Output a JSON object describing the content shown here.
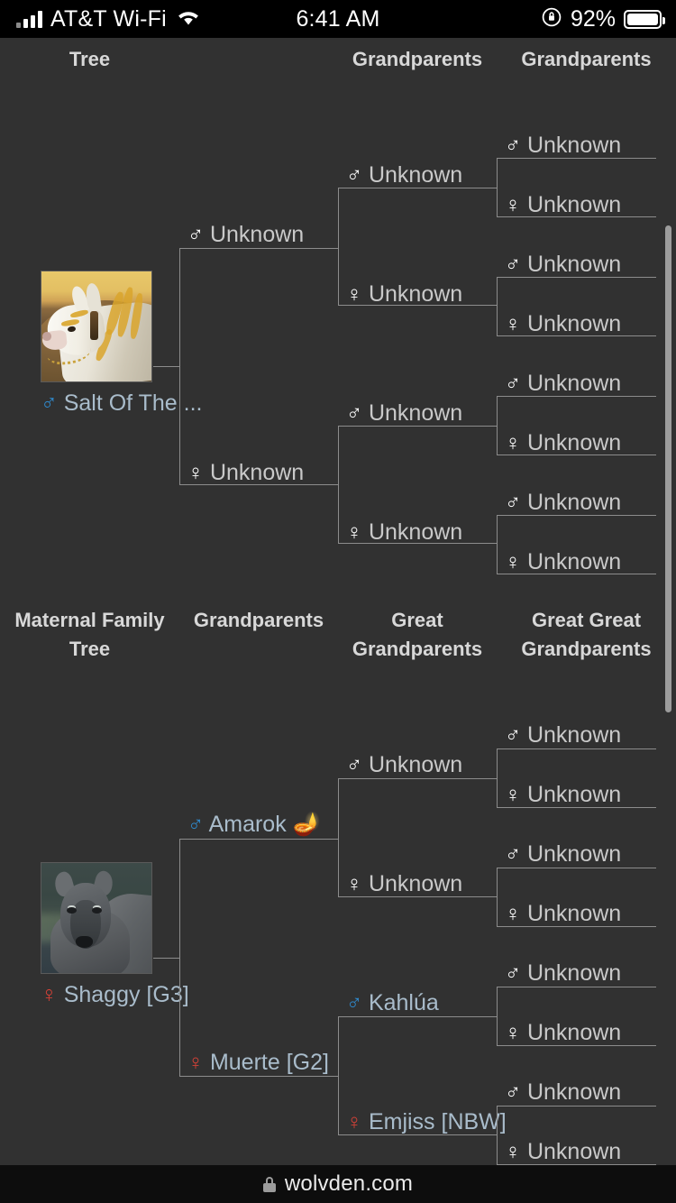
{
  "status_bar": {
    "carrier": "AT&T Wi-Fi",
    "time": "6:41 AM",
    "battery_percent": "92%",
    "signal_icon": "cellular-bars-icon",
    "wifi_icon": "wifi-icon",
    "orientation_lock_icon": "rotation-lock-icon",
    "battery_icon": "battery-icon"
  },
  "browser": {
    "url": "wolvden.com",
    "lock_icon": "lock-icon"
  },
  "paternal": {
    "headers": [
      "Tree",
      "",
      "Grandparents",
      "Grandparents"
    ],
    "header_note_clipped": "Paternal Family Tree header is scrolled partly off-screen",
    "subject": {
      "name": "Salt Of The ...",
      "sex": "male",
      "symbol": "♂",
      "art": "art-salt"
    },
    "parents": [
      {
        "name": "Unknown",
        "sex": "male",
        "symbol": "♂"
      },
      {
        "name": "Unknown",
        "sex": "female",
        "symbol": "♀"
      }
    ],
    "grandparents": [
      {
        "name": "Unknown",
        "sex": "male",
        "symbol": "♂"
      },
      {
        "name": "Unknown",
        "sex": "female",
        "symbol": "♀"
      },
      {
        "name": "Unknown",
        "sex": "male",
        "symbol": "♂"
      },
      {
        "name": "Unknown",
        "sex": "female",
        "symbol": "♀"
      }
    ],
    "great_grandparents": [
      {
        "name": "Unknown",
        "sex": "male",
        "symbol": "♂"
      },
      {
        "name": "Unknown",
        "sex": "female",
        "symbol": "♀"
      },
      {
        "name": "Unknown",
        "sex": "male",
        "symbol": "♂"
      },
      {
        "name": "Unknown",
        "sex": "female",
        "symbol": "♀"
      },
      {
        "name": "Unknown",
        "sex": "male",
        "symbol": "♂"
      },
      {
        "name": "Unknown",
        "sex": "female",
        "symbol": "♀"
      },
      {
        "name": "Unknown",
        "sex": "male",
        "symbol": "♂"
      },
      {
        "name": "Unknown",
        "sex": "female",
        "symbol": "♀"
      }
    ]
  },
  "maternal": {
    "headers": [
      "Maternal Family Tree",
      "Grandparents",
      "Great Grandparents",
      "Great Great Grandparents"
    ],
    "subject": {
      "name": "Shaggy [G3]",
      "sex": "female",
      "symbol": "♀",
      "art": "art-shaggy"
    },
    "parents": [
      {
        "name": "Amarok 🪔",
        "sex": "male",
        "symbol": "♂",
        "link": true
      },
      {
        "name": "Muerte [G2]",
        "sex": "female",
        "symbol": "♀",
        "link": true
      }
    ],
    "grandparents": [
      {
        "name": "Unknown",
        "sex": "male",
        "symbol": "♂"
      },
      {
        "name": "Unknown",
        "sex": "female",
        "symbol": "♀"
      },
      {
        "name": "Kahlúa",
        "sex": "male",
        "symbol": "♂",
        "link": true
      },
      {
        "name": "Emjiss [NBW]",
        "sex": "female",
        "symbol": "♀",
        "link": true
      }
    ],
    "great_grandparents": [
      {
        "name": "Unknown",
        "sex": "male",
        "symbol": "♂"
      },
      {
        "name": "Unknown",
        "sex": "female",
        "symbol": "♀"
      },
      {
        "name": "Unknown",
        "sex": "male",
        "symbol": "♂"
      },
      {
        "name": "Unknown",
        "sex": "female",
        "symbol": "♀"
      },
      {
        "name": "Unknown",
        "sex": "male",
        "symbol": "♂"
      },
      {
        "name": "Unknown",
        "sex": "female",
        "symbol": "♀"
      },
      {
        "name": "Unknown",
        "sex": "male",
        "symbol": "♂"
      },
      {
        "name": "Unknown",
        "sex": "female",
        "symbol": "♀"
      }
    ]
  },
  "colors": {
    "background": "#313131",
    "male": "#2f89cc",
    "female": "#d24137",
    "link": "#a9bccb",
    "text": "#c9c9c9",
    "border": "#8c8c8c"
  }
}
